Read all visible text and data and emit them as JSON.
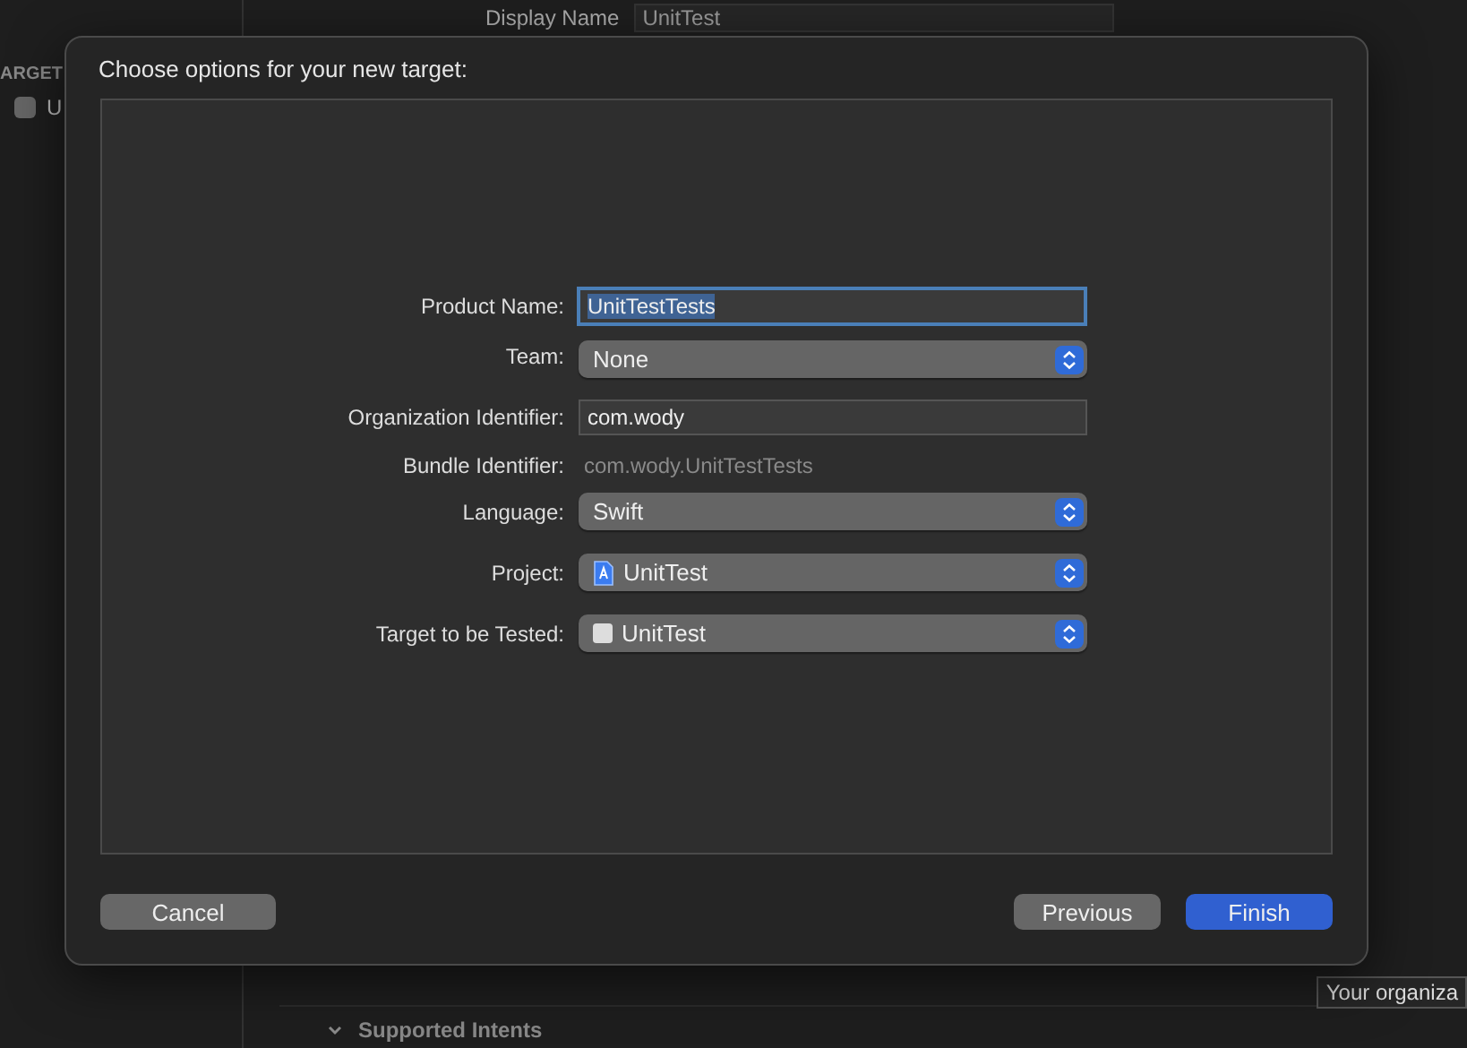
{
  "background": {
    "sidebar": {
      "section_label": "ARGET",
      "items": [
        {
          "label": "U"
        }
      ]
    },
    "settings": {
      "label": "Display Name",
      "value": "UnitTest"
    },
    "section": {
      "title": "Supported Intents",
      "expanded": true
    },
    "tooltip": "Your organiza"
  },
  "dialog": {
    "title": "Choose options for your new target:",
    "fields": [
      {
        "kind": "text",
        "label": "Product Name:",
        "value": "UnitTestTests",
        "focused": true
      },
      {
        "kind": "popup",
        "label": "Team:",
        "value": "None"
      },
      {
        "kind": "text",
        "label": "Organization Identifier:",
        "value": "com.wody",
        "focused": false
      },
      {
        "kind": "static",
        "label": "Bundle Identifier:",
        "value": "com.wody.UnitTestTests"
      },
      {
        "kind": "popup",
        "label": "Language:",
        "value": "Swift"
      },
      {
        "kind": "project_popup",
        "label": "Project:",
        "value": "UnitTest"
      },
      {
        "kind": "target_popup",
        "label": "Target to be Tested:",
        "value": "UnitTest"
      }
    ],
    "buttons": [
      {
        "label": "Cancel",
        "kind": "secondary"
      },
      {
        "label": "Previous",
        "kind": "secondary"
      },
      {
        "label": "Finish",
        "kind": "primary"
      }
    ]
  }
}
